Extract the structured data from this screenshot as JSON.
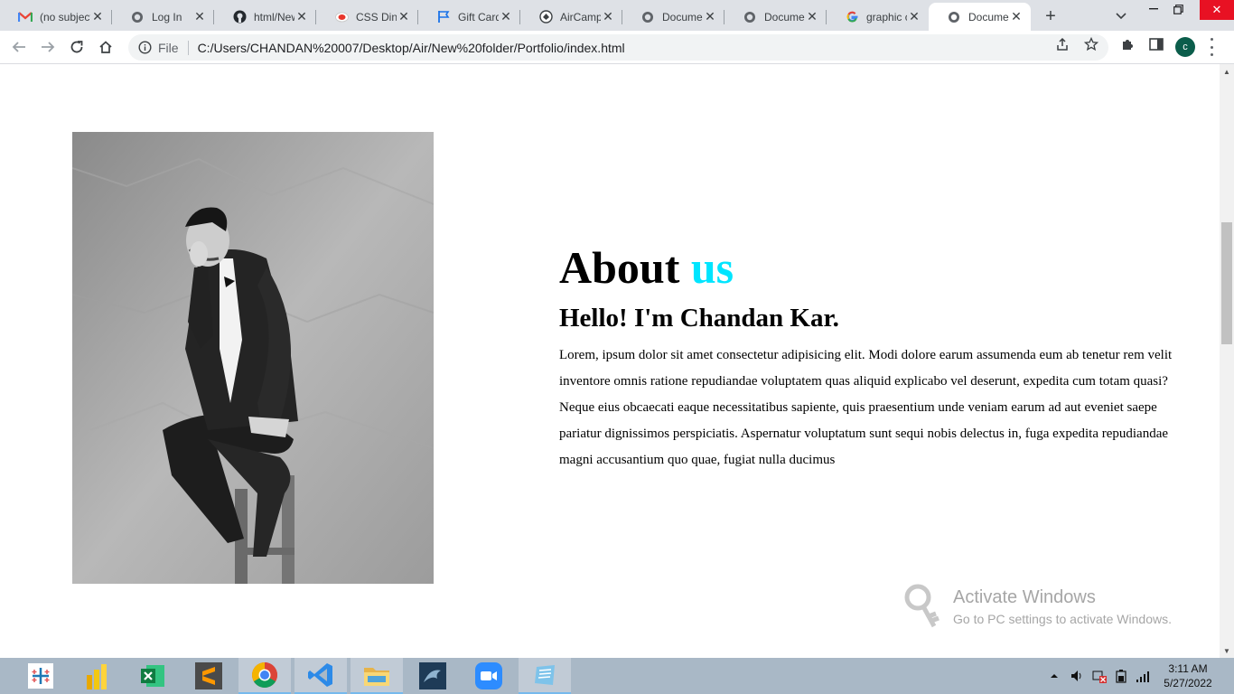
{
  "browser": {
    "tabs": [
      {
        "title": "(no subject)",
        "icon": "gmail-icon",
        "active": false
      },
      {
        "title": "Log In",
        "icon": "globe-icon",
        "active": false
      },
      {
        "title": "html/New",
        "icon": "github-icon",
        "active": false
      },
      {
        "title": "CSS Diner",
        "icon": "css-diner-icon",
        "active": false
      },
      {
        "title": "Gift Card",
        "icon": "flag-icon",
        "active": false
      },
      {
        "title": "AirCampus",
        "icon": "aircampus-icon",
        "active": false
      },
      {
        "title": "Document",
        "icon": "globe-icon",
        "active": false
      },
      {
        "title": "Document",
        "icon": "globe-icon",
        "active": false
      },
      {
        "title": "graphic c",
        "icon": "google-icon",
        "active": false
      },
      {
        "title": "Document",
        "icon": "globe-icon",
        "active": true
      }
    ],
    "address": {
      "scheme_label": "File",
      "url": "C:/Users/CHANDAN%20007/Desktop/Air/New%20folder/Portfolio/index.html"
    },
    "profile_initial": "c"
  },
  "page": {
    "heading_main": "About",
    "heading_accent": "us",
    "subheading": "Hello! I'm Chandan Kar.",
    "paragraph": "Lorem, ipsum dolor sit amet consectetur adipisicing elit. Modi dolore earum assumenda eum ab tenetur rem velit inventore omnis ratione repudiandae voluptatem quas aliquid explicabo vel deserunt, expedita cum totam quasi? Neque eius obcaecati eaque necessitatibus sapiente, quis praesentium unde veniam earum ad aut eveniet saepe pariatur dignissimos perspiciatis. Aspernatur voluptatum sunt sequi nobis delectus in, fuga expedita repudiandae magni accusantium quo quae, fugiat nulla ducimus",
    "accent_color": "#00e5ff"
  },
  "watermark": {
    "title": "Activate Windows",
    "subtitle": "Go to PC settings to activate Windows."
  },
  "taskbar": {
    "apps": [
      "tableau-icon",
      "power-bi-icon",
      "excel-icon",
      "sublime-text-icon",
      "chrome-icon",
      "vscode-icon",
      "file-explorer-icon",
      "mysql-workbench-icon",
      "zoom-icon",
      "notepad-icon"
    ],
    "time": "3:11 AM",
    "date": "5/27/2022"
  }
}
